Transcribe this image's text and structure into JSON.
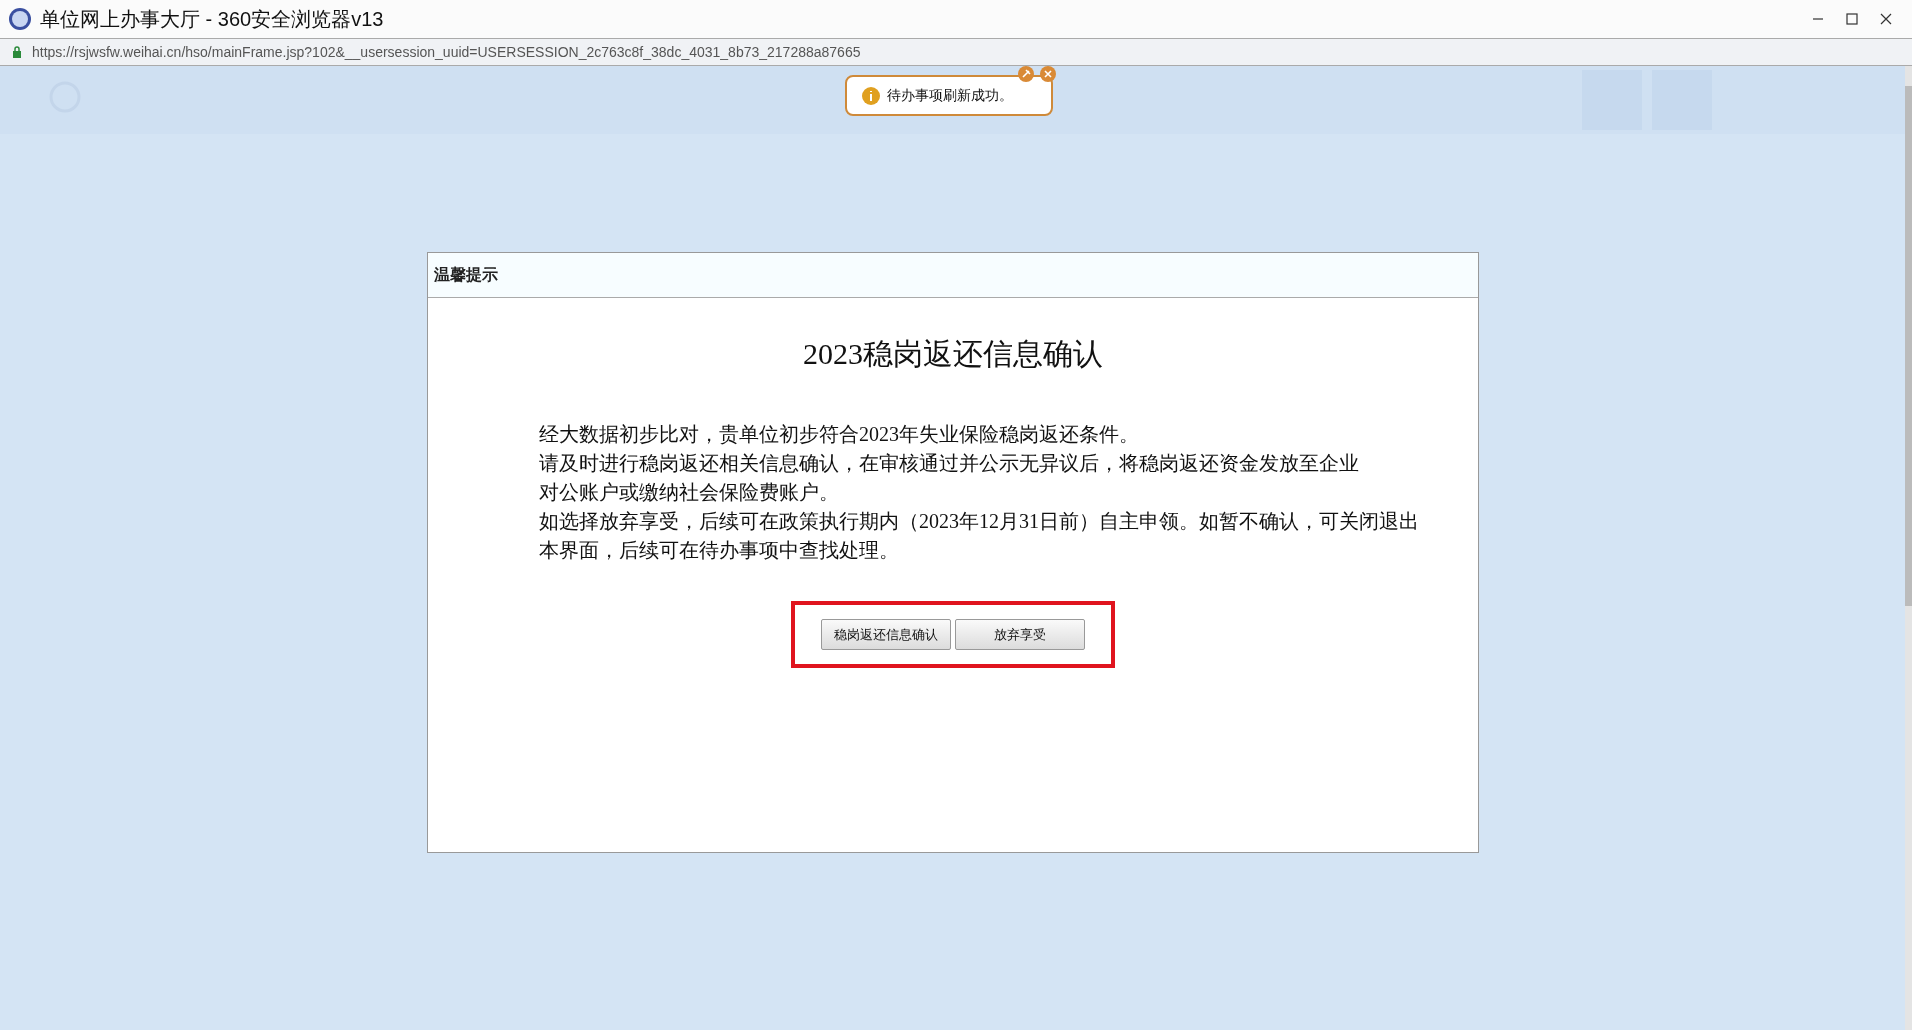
{
  "window": {
    "title": "单位网上办事大厅 - 360安全浏览器v13"
  },
  "address_bar": {
    "url": "https://rsjwsfw.weihai.cn/hso/mainFrame.jsp?102&__usersession_uuid=USERSESSION_2c763c8f_38dc_4031_8b73_217288a87665"
  },
  "toast": {
    "message": "待办事项刷新成功。"
  },
  "dialog": {
    "header": "温馨提示",
    "title": "2023稳岗返还信息确认",
    "lines": [
      "经大数据初步比对，贵单位初步符合2023年失业保险稳岗返还条件。",
      "请及时进行稳岗返还相关信息确认，在审核通过并公示无异议后，将稳岗返还资金发放至企业",
      "对公账户或缴纳社会保险费账户。",
      "如选择放弃享受，后续可在政策执行期内（2023年12月31日前）自主申领。如暂不确认，可关闭退出",
      "本界面，后续可在待办事项中查找处理。"
    ],
    "buttons": [
      "稳岗返还信息确认",
      "放弃享受"
    ]
  }
}
